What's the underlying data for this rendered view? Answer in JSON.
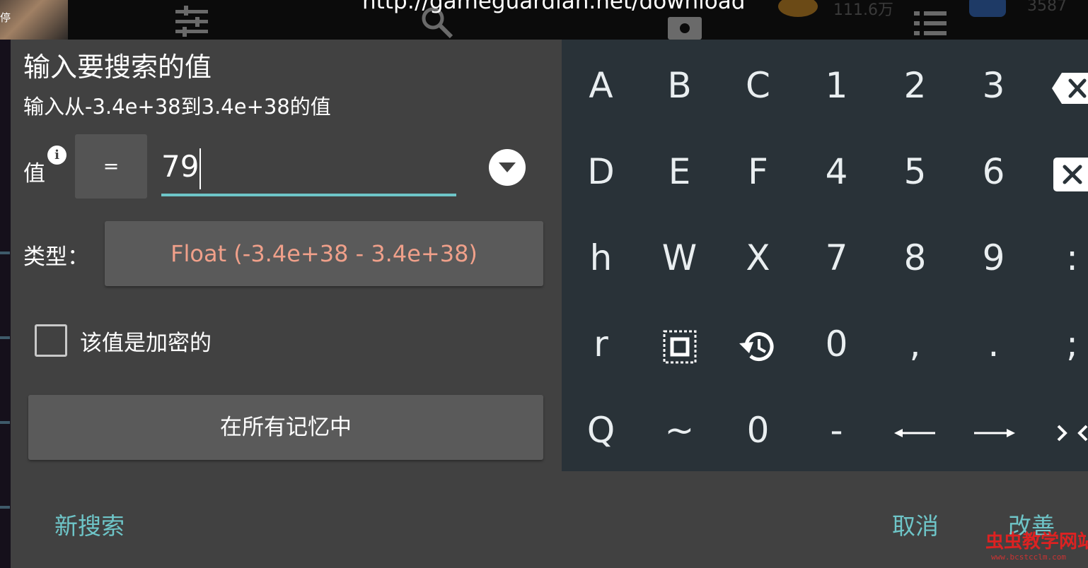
{
  "background": {
    "pause_label": "停",
    "url": "http://gameguardian.net/download",
    "stat_left": "111.6万",
    "stat_right": "3587"
  },
  "dialog": {
    "title": "输入要搜索的值",
    "subtitle": "输入从-3.4e+38到3.4e+38的值",
    "value_label": "值",
    "info_icon": "i",
    "operator": "=",
    "value": "79",
    "type_label": "类型：",
    "type_value": "Float (-3.4e+38 - 3.4e+38)",
    "encrypted_label": "该值是加密的",
    "encrypted_checked": false,
    "memory_button": "在所有记忆中",
    "new_search": "新搜索",
    "cancel": "取消",
    "improve": "改善",
    "accent_color": "#6ec5c8",
    "type_color": "#f0a08a"
  },
  "keyboard": {
    "rows": [
      [
        "A",
        "B",
        "C",
        "1",
        "2",
        "3",
        "backspace-icon"
      ],
      [
        "D",
        "E",
        "F",
        "4",
        "5",
        "6",
        "clear-icon"
      ],
      [
        "h",
        "W",
        "X",
        "7",
        "8",
        "9",
        ":"
      ],
      [
        "r",
        "select-all-icon",
        "history-icon",
        "0",
        ",",
        ".",
        ";"
      ],
      [
        "Q",
        "~",
        "0",
        "-",
        "arrow-left-icon",
        "arrow-right-icon",
        "swap-icon"
      ]
    ]
  },
  "watermark": {
    "text": "虫虫教学网站",
    "url": "www.bcstcclm.com"
  }
}
